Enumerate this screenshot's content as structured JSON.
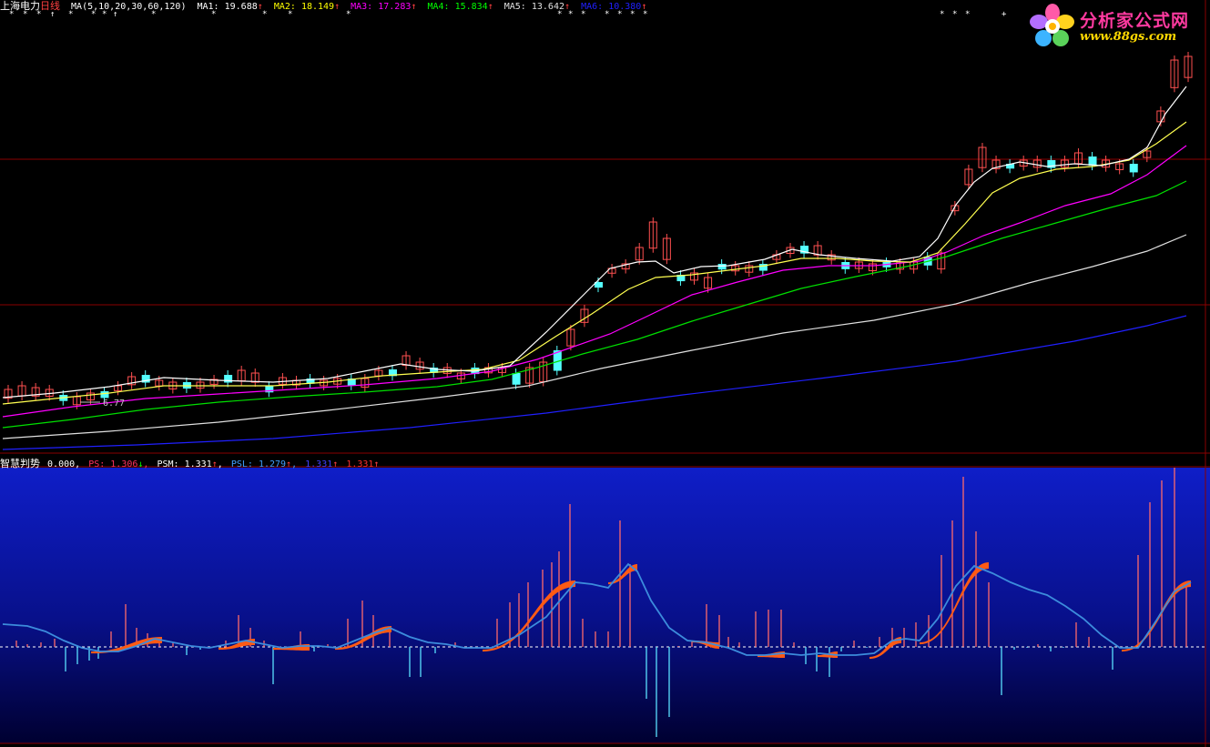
{
  "main_header": {
    "stock_name": "上海电力",
    "period": "日线",
    "ma_params": "MA(5,10,20,30,60,120)",
    "items": [
      {
        "label": "MA1:",
        "value": "19.688",
        "arrow": "↑",
        "color": "#ffffff"
      },
      {
        "label": "MA2:",
        "value": "18.149",
        "arrow": "↑",
        "color": "#ffff00"
      },
      {
        "label": "MA3:",
        "value": "17.283",
        "arrow": "↑",
        "color": "#ff00ff"
      },
      {
        "label": "MA4:",
        "value": "15.834",
        "arrow": "↑",
        "color": "#00ff00"
      },
      {
        "label": "MA5:",
        "value": "13.642",
        "arrow": "↑",
        "color": "#e0e0e0"
      },
      {
        "label": "MA6:",
        "value": "10.380",
        "arrow": "↑",
        "color": "#2020ff"
      }
    ]
  },
  "low_price_label": "6.77",
  "indicator_header": {
    "name": "智慧判势",
    "value0": "0.000,",
    "items": [
      {
        "label": "PS:",
        "value": "1.306",
        "arrow": "↓",
        "color": "#ff3060"
      },
      {
        "label": "PSM:",
        "value": "1.331",
        "arrow": "↑",
        "color": "#ffffff"
      },
      {
        "label": "PSL:",
        "value": "1.279",
        "arrow": "↑",
        "color": "#40a0ff"
      },
      {
        "label": "",
        "value": "1.331",
        "arrow": "↑",
        "color": "#4040ff"
      },
      {
        "label": "",
        "value": "1.331",
        "arrow": "↑",
        "color": "#ff3030"
      }
    ]
  },
  "watermark": {
    "title": "分析家公式网",
    "url": "www.88gs.com"
  },
  "colors": {
    "up": "#ff5050",
    "down": "#54ffff",
    "grid": "#8a0000",
    "panel_top": "#0f1ec8",
    "panel_bottom": "#000030",
    "band": "#ff5a14",
    "ps_line": "#3c8cdc"
  },
  "stars": {
    "glyph": "*",
    "up_arrow": "↑"
  }
}
